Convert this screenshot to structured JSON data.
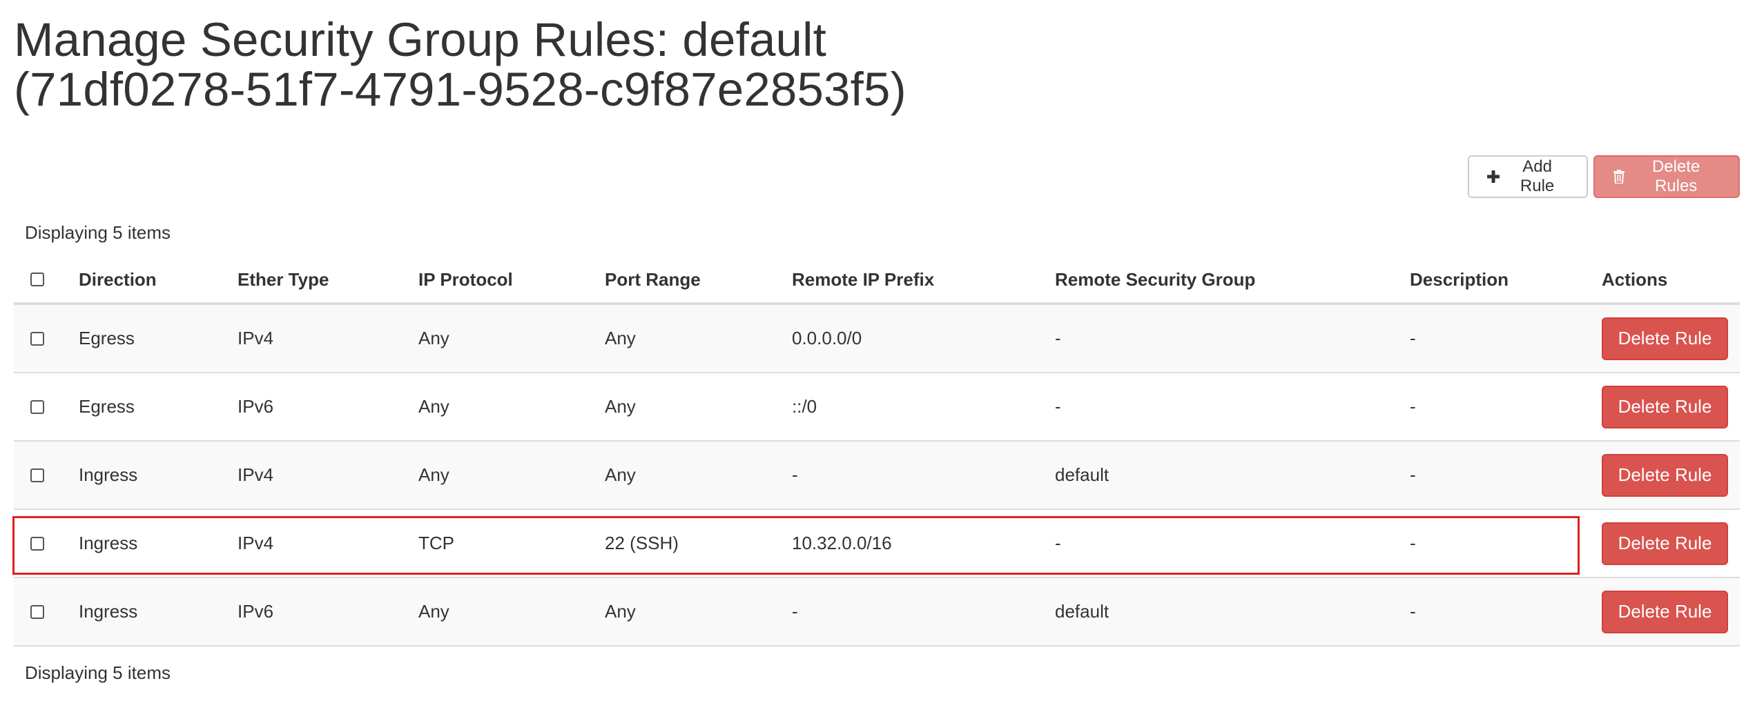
{
  "page": {
    "title_line1": "Manage Security Group Rules: default",
    "title_line2": "(71df0278-51f7-4791-9528-c9f87e2853f5)"
  },
  "toolbar": {
    "add_rule_label": "Add Rule",
    "delete_rules_label": "Delete Rules"
  },
  "table": {
    "count_top": "Displaying 5 items",
    "count_bottom": "Displaying 5 items",
    "columns": {
      "direction": "Direction",
      "ether_type": "Ether Type",
      "ip_protocol": "IP Protocol",
      "port_range": "Port Range",
      "remote_ip_prefix": "Remote IP Prefix",
      "remote_security_group": "Remote Security Group",
      "description": "Description",
      "actions": "Actions"
    },
    "rows": [
      {
        "direction": "Egress",
        "ether_type": "IPv4",
        "ip_protocol": "Any",
        "port_range": "Any",
        "remote_ip_prefix": "0.0.0.0/0",
        "remote_security_group": "-",
        "description": "-",
        "action_label": "Delete Rule"
      },
      {
        "direction": "Egress",
        "ether_type": "IPv6",
        "ip_protocol": "Any",
        "port_range": "Any",
        "remote_ip_prefix": "::/0",
        "remote_security_group": "-",
        "description": "-",
        "action_label": "Delete Rule"
      },
      {
        "direction": "Ingress",
        "ether_type": "IPv4",
        "ip_protocol": "Any",
        "port_range": "Any",
        "remote_ip_prefix": "-",
        "remote_security_group": "default",
        "description": "-",
        "action_label": "Delete Rule"
      },
      {
        "direction": "Ingress",
        "ether_type": "IPv4",
        "ip_protocol": "TCP",
        "port_range": "22 (SSH)",
        "remote_ip_prefix": "10.32.0.0/16",
        "remote_security_group": "-",
        "description": "-",
        "action_label": "Delete Rule"
      },
      {
        "direction": "Ingress",
        "ether_type": "IPv6",
        "ip_protocol": "Any",
        "port_range": "Any",
        "remote_ip_prefix": "-",
        "remote_security_group": "default",
        "description": "-",
        "action_label": "Delete Rule"
      }
    ]
  },
  "icons": {
    "add": "plus-icon",
    "delete": "trash-icon"
  },
  "colors": {
    "danger": "#d9534f",
    "danger_disabled": "#e48a87",
    "highlight_box": "#e02020"
  }
}
